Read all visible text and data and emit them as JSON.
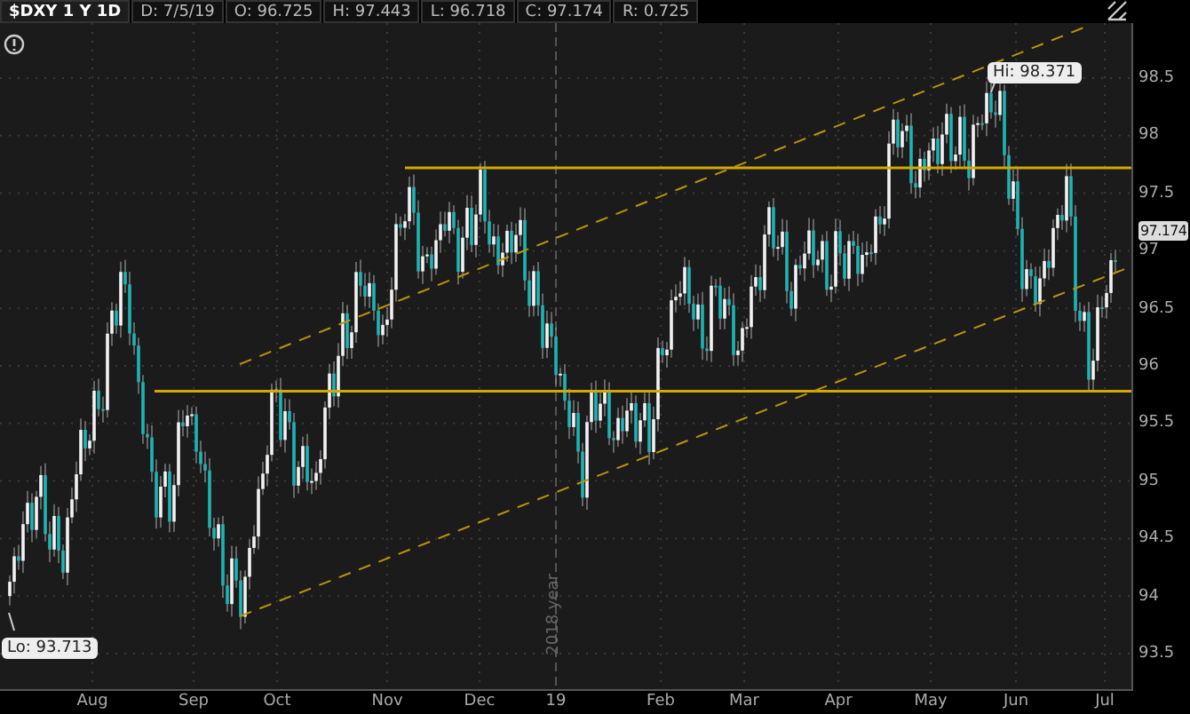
{
  "header": {
    "symbol": "$DXY 1 Y 1D",
    "fields": [
      "D: 7/5/19",
      "O: 96.725",
      "H: 97.443",
      "L: 96.718",
      "C: 97.174",
      "R: 0.725"
    ]
  },
  "chart": {
    "y_axis": [
      "98.5",
      "98",
      "97.5",
      "97",
      "96.5",
      "96",
      "95.5",
      "95",
      "94.5",
      "94",
      "93.5"
    ],
    "x_axis": [
      "Aug",
      "Sep",
      "Oct",
      "Nov",
      "Dec",
      "19",
      "Feb",
      "Mar",
      "Apr",
      "May",
      "Jun",
      "Jul"
    ],
    "high_label": "Hi: 98.371",
    "low_label": "Lo: 93.713",
    "last_price": "97.174",
    "year_divider": "2018 year"
  }
}
